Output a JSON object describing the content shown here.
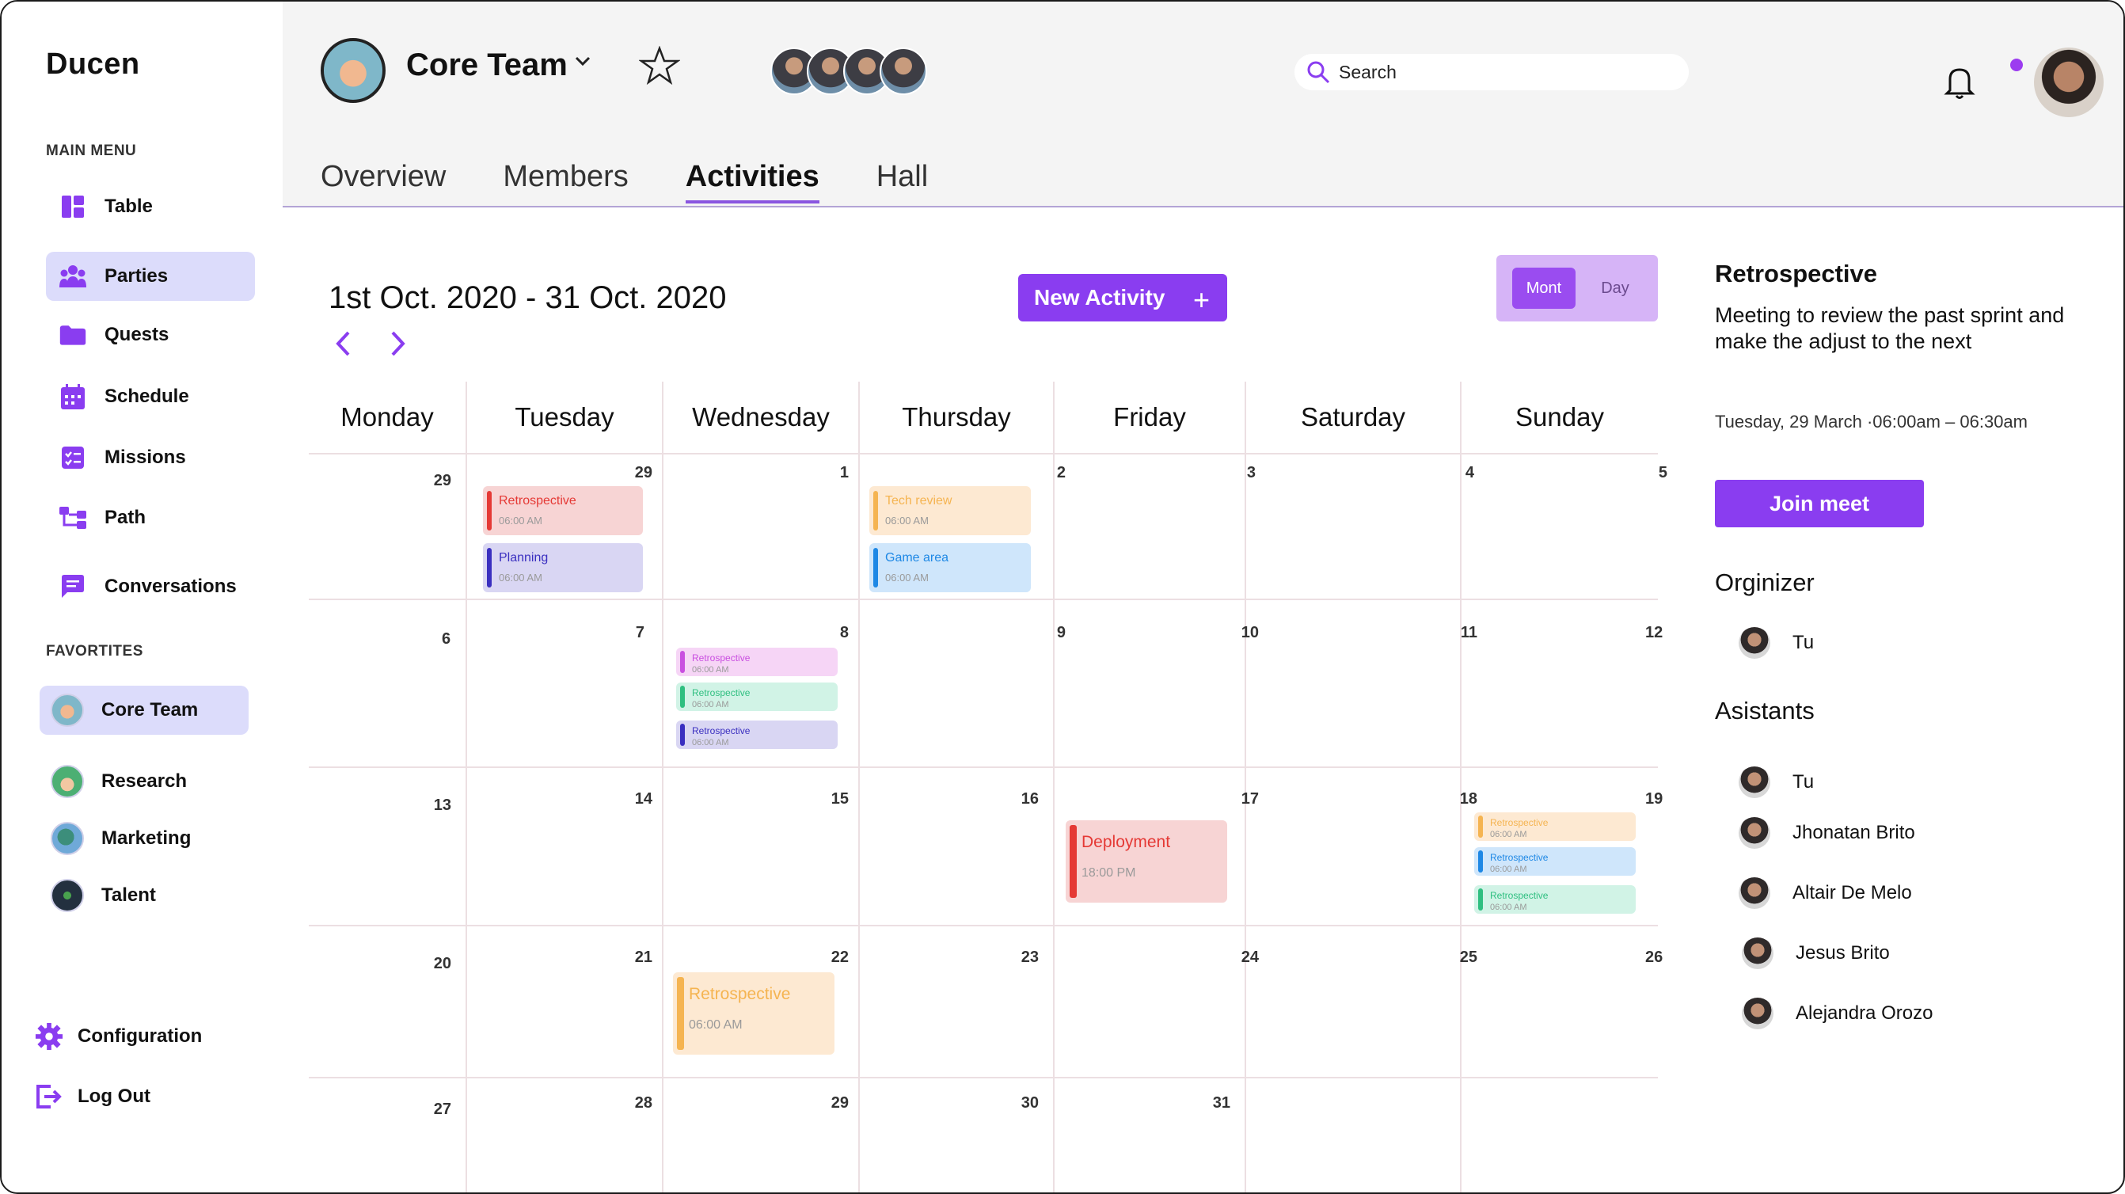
{
  "brand": "Ducen",
  "sidebar": {
    "main_menu_label": "MAIN MENU",
    "items": [
      {
        "label": "Table",
        "icon": "table-icon"
      },
      {
        "label": "Parties",
        "icon": "people-icon"
      },
      {
        "label": "Quests",
        "icon": "folder-icon"
      },
      {
        "label": "Schedule",
        "icon": "calendar-icon"
      },
      {
        "label": "Missions",
        "icon": "checklist-icon"
      },
      {
        "label": "Path",
        "icon": "hierarchy-icon"
      },
      {
        "label": "Conversations",
        "icon": "chat-icon"
      }
    ],
    "favorites_label": "FAVORTITES",
    "favorites": [
      {
        "label": "Core Team"
      },
      {
        "label": "Research"
      },
      {
        "label": "Marketing"
      },
      {
        "label": "Talent"
      }
    ],
    "configuration": "Configuration",
    "logout": "Log Out"
  },
  "header": {
    "team_name": "Core Team",
    "search_placeholder": "Search",
    "tabs": [
      "Overview",
      "Members",
      "Activities",
      "Hall"
    ],
    "active_tab": "Activities"
  },
  "calendar": {
    "range": "1st Oct. 2020 - 31 Oct. 2020",
    "new_activity": "New Activity",
    "new_activity_plus": "+",
    "view_toggle": {
      "month": "Mont",
      "day": "Day"
    },
    "weekdays": [
      "Monday",
      "Tuesday",
      "Wednesday",
      "Thursday",
      "Friday",
      "Saturday",
      "Sunday"
    ],
    "weeks": [
      [
        "29",
        "29",
        "1",
        "2",
        "3",
        "4",
        "5"
      ],
      [
        "6",
        "7",
        "8",
        "9",
        "10",
        "11",
        "12"
      ],
      [
        "13",
        "14",
        "15",
        "16",
        "17",
        "18",
        "19"
      ],
      [
        "20",
        "21",
        "22",
        "23",
        "24",
        "25",
        "26"
      ],
      [
        "27",
        "28",
        "29",
        "30",
        "31",
        "",
        ""
      ]
    ],
    "events": [
      {
        "title": "Retrospective",
        "time": "06:00 AM",
        "color": "#e53935",
        "bg": "#f7d4d4"
      },
      {
        "title": "Planning",
        "time": "06:00 AM",
        "color": "#3a2fc0",
        "bg": "#d9d6f3"
      },
      {
        "title": "Tech review",
        "time": "06:00 AM",
        "color": "#f5b451",
        "bg": "#fde9d2"
      },
      {
        "title": "Game area",
        "time": "06:00 AM",
        "color": "#1e88e5",
        "bg": "#cfe6fb"
      },
      {
        "title": "Retrospective",
        "time": "06:00 AM",
        "color": "#c94fe0",
        "bg": "#f6d5f6"
      },
      {
        "title": "Retrospective",
        "time": "06:00 AM",
        "color": "#2fbf80",
        "bg": "#d1f3e6"
      },
      {
        "title": "Retrospective",
        "time": "06:00 AM",
        "color": "#3a2fc0",
        "bg": "#d9d6f3"
      },
      {
        "title": "Deployment",
        "time": "18:00 PM",
        "color": "#e53935",
        "bg": "#f7d4d4"
      },
      {
        "title": "Retrospective",
        "time": "06:00 AM",
        "color": "#f5b451",
        "bg": "#fde9d2"
      },
      {
        "title": "Retrospective",
        "time": "06:00 AM",
        "color": "#1e88e5",
        "bg": "#cfe6fb"
      },
      {
        "title": "Retrospective",
        "time": "06:00 AM",
        "color": "#2fbf80",
        "bg": "#d1f3e6"
      },
      {
        "title": "Retrospective",
        "time": "06:00 AM",
        "color": "#f5b451",
        "bg": "#fde9d2"
      }
    ]
  },
  "detail": {
    "title": "Retrospective",
    "description": "Meeting to review the past sprint and make the  adjust to the next",
    "when": "Tuesday, 29 March ·06:00am – 06:30am",
    "join": "Join meet",
    "organizer_label": "Orginizer",
    "organizer": "Tu",
    "assistants_label": "Asistants",
    "assistants": [
      "Tu",
      "Jhonatan Brito",
      "Altair De Melo",
      "Jesus Brito",
      "Alejandra Orozo"
    ]
  },
  "colors": {
    "accent": "#8a3df0",
    "active_nav": "#dcdcfb",
    "header_bg": "#f4f4f4"
  }
}
